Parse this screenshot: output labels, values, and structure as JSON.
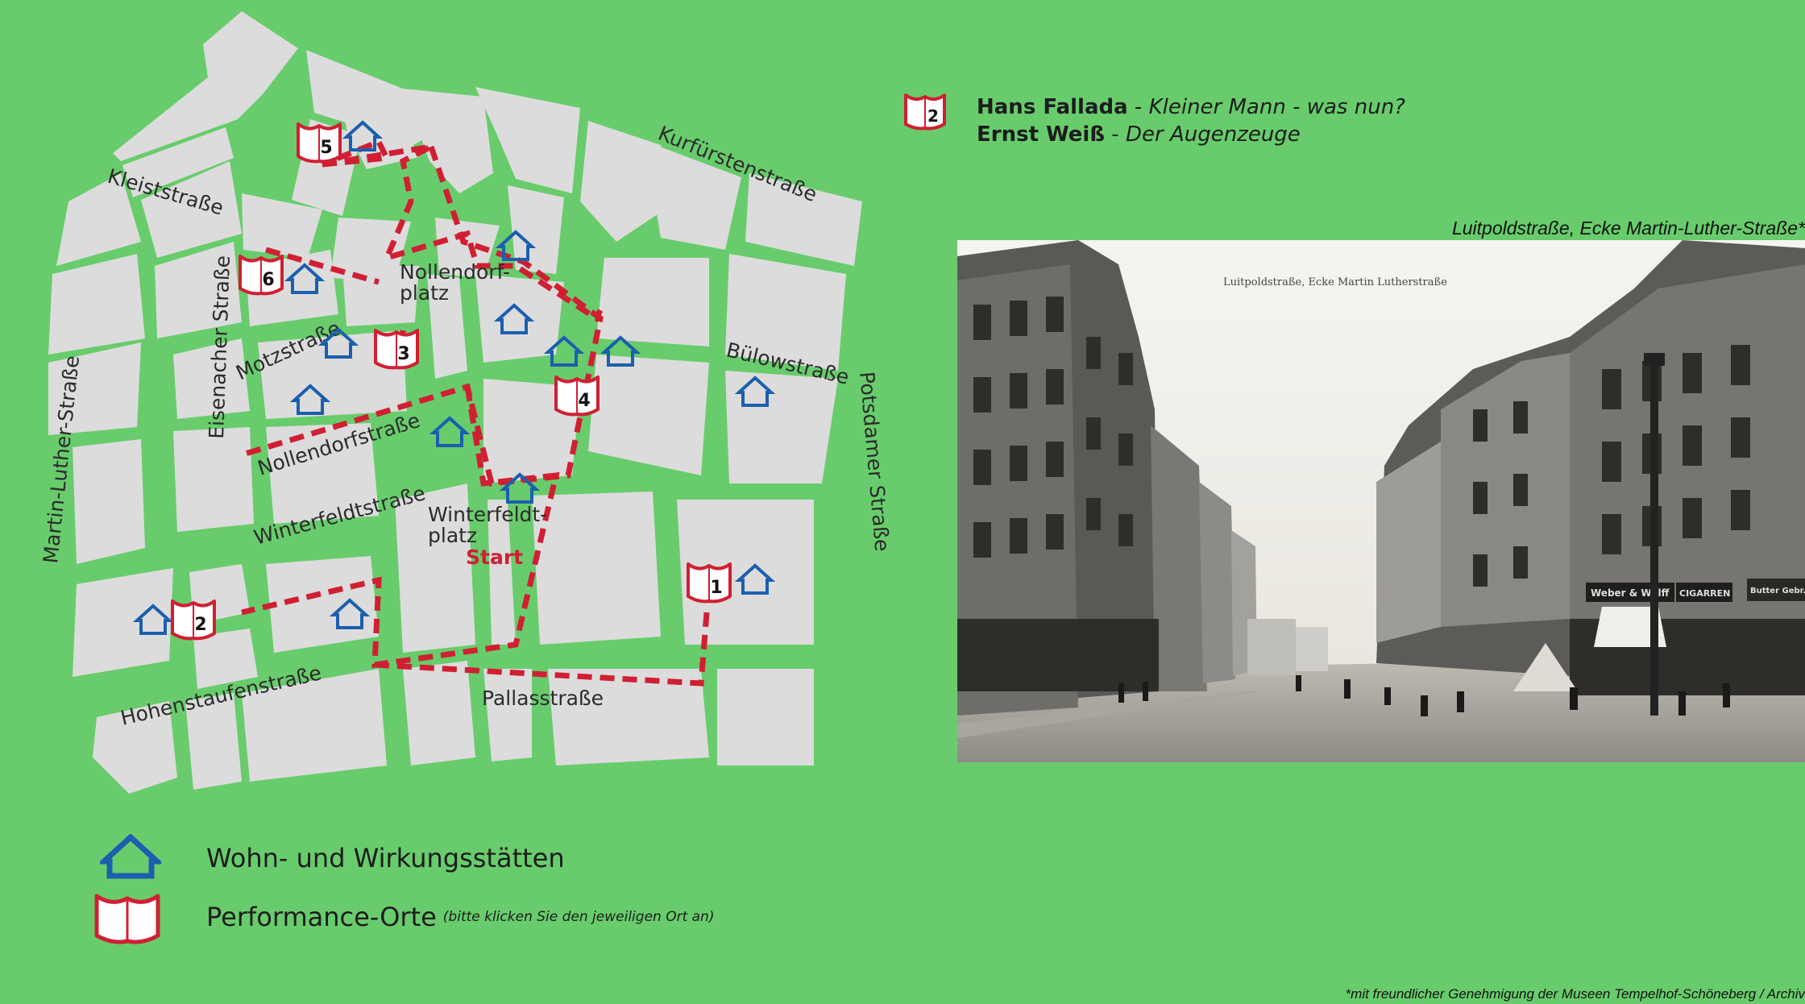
{
  "map": {
    "streets": {
      "kleiststrasse": "Kleiststraße",
      "kurfuerstenstrasse": "Kurfürstenstraße",
      "motzstrasse": "Motzstraße",
      "buelowstrasse": "Bülowstraße",
      "eisenacher": "Eisenacher Straße",
      "potsdamer": "Potsdamer Straße",
      "martin_luther": "Martin-Luther-Straße",
      "nollendorfstrasse": "Nollendorfstraße",
      "winterfeldtstrasse": "Winterfeldtstraße",
      "hohenstaufenstrasse": "Hohenstaufenstraße",
      "pallasstrasse": "Pallasstraße"
    },
    "places": {
      "nollendorfplatz_1": "Nollendorf-",
      "nollendorfplatz_2": "platz",
      "winterfeldtplatz_1": "Winterfeldt-",
      "winterfeldtplatz_2": "platz"
    },
    "start_label": "Start",
    "markers": [
      "1",
      "2",
      "3",
      "4",
      "5",
      "6"
    ],
    "colors": {
      "background": "#68cc6c",
      "blocks": "#dcdcdc",
      "route": "#d01f33",
      "house": "#1b5fae"
    }
  },
  "book_info": {
    "marker": "2",
    "author1": "Hans Fallada",
    "sep1": " - ",
    "title1": "Kleiner Mann - was nun?",
    "author2": "Ernst Weiß",
    "sep2": " - ",
    "title2": "Der Augenzeuge"
  },
  "photo": {
    "caption": "Luitpoldstraße, Ecke Martin-Luther-Straße*",
    "inscription": "Luitpoldstraße, Ecke Martin Lutherstraße",
    "shop_signs": [
      "Weber & Wolff",
      "CIGARREN",
      "Butter Gebr."
    ]
  },
  "legend": {
    "house_label": "Wohn- und Wirkungsstätten",
    "book_label": "Performance-Orte",
    "book_hint": "(bitte klicken Sie den jeweiligen Ort an)",
    "house_icon": "house-icon",
    "book_icon": "open-book-icon"
  },
  "credit": "*mit freundlicher Genehmigung der Museen Tempelhof-Schöneberg / Archiv"
}
